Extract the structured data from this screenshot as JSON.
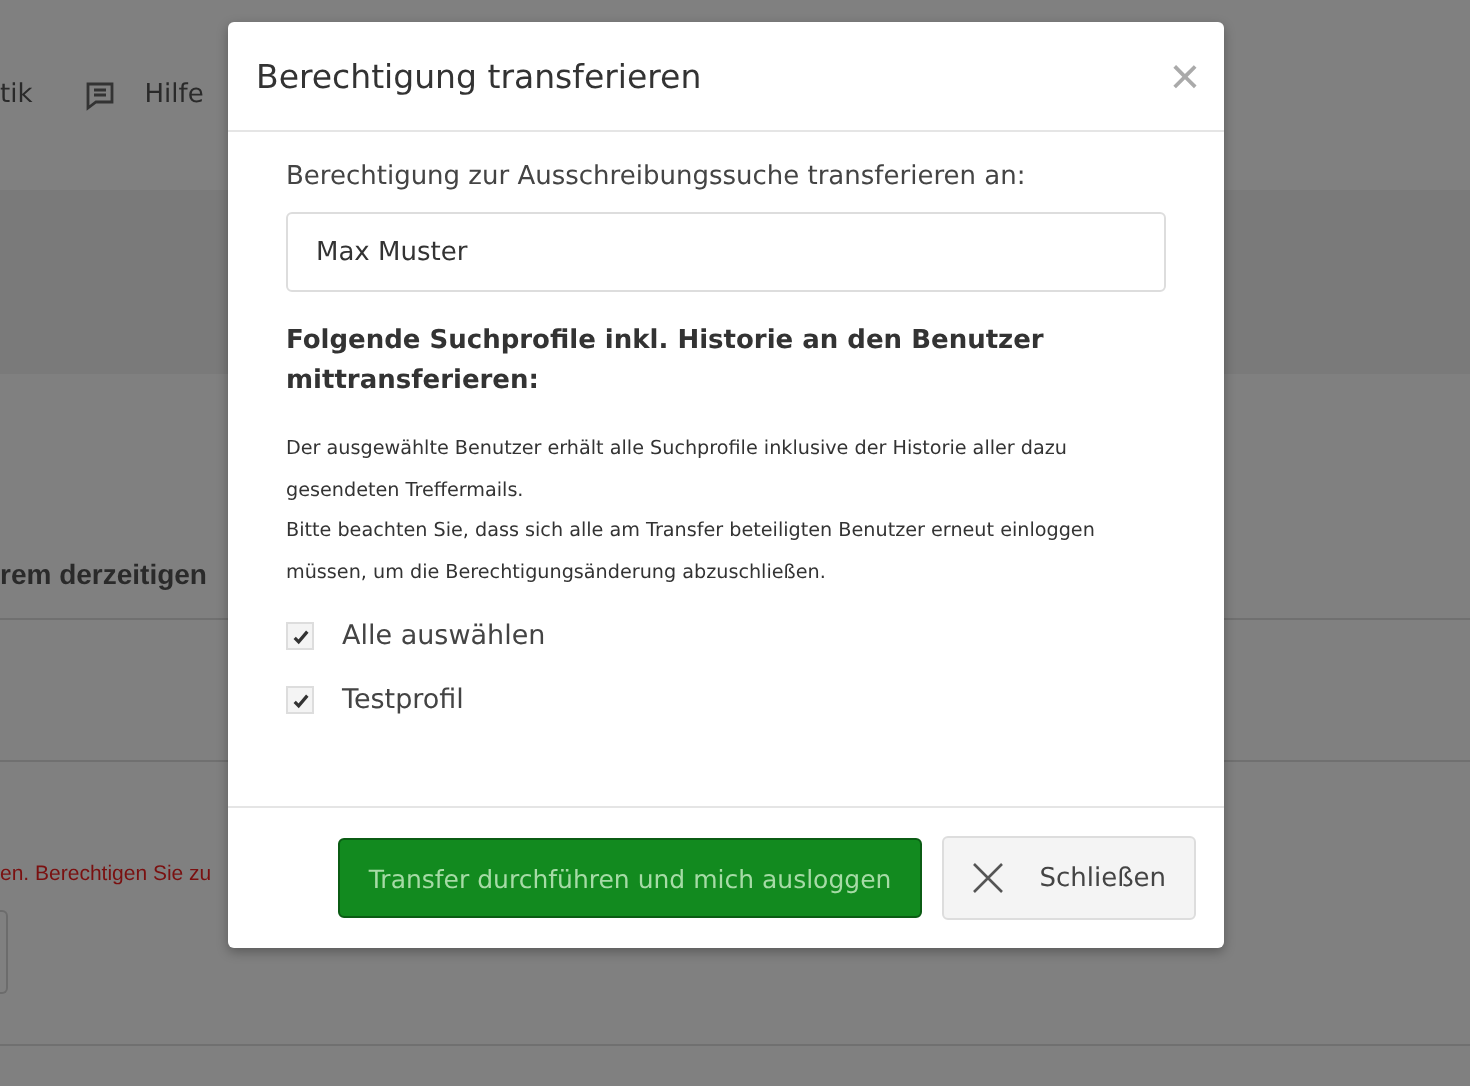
{
  "background": {
    "nav": [
      {
        "label": "tik",
        "icon": false
      },
      {
        "label": "Hilfe",
        "icon": true
      }
    ],
    "heading": "rem derzeitigen",
    "warning": "en. Berechtigen Sie zu"
  },
  "dialog": {
    "title": "Berechtigung transferieren",
    "close": "×",
    "field_label": "Berechtigung zur Ausschreibungssuche transferieren an:",
    "field_value": "Max Muster",
    "section_title": "Folgende Suchprofile inkl. Historie an den Benutzer mittransferieren:",
    "info": [
      "Der ausgewählte Benutzer erhält alle Suchprofile inklusive der Historie aller dazu gesendeten Treffermails.",
      "Bitte beachten Sie, dass sich alle am Transfer beteiligten Benutzer erneut einloggen müssen, um die Berechtigungsänderung abzuschließen."
    ],
    "options": [
      {
        "label": "Alle auswählen",
        "checked": true
      },
      {
        "label": "Testprofil",
        "checked": true
      }
    ],
    "buttons": [
      {
        "kind": "primary",
        "label": "Transfer durchführen und mich ausloggen",
        "disabled": true
      },
      {
        "kind": "close",
        "label": "Schließen",
        "disabled": false
      }
    ]
  }
}
